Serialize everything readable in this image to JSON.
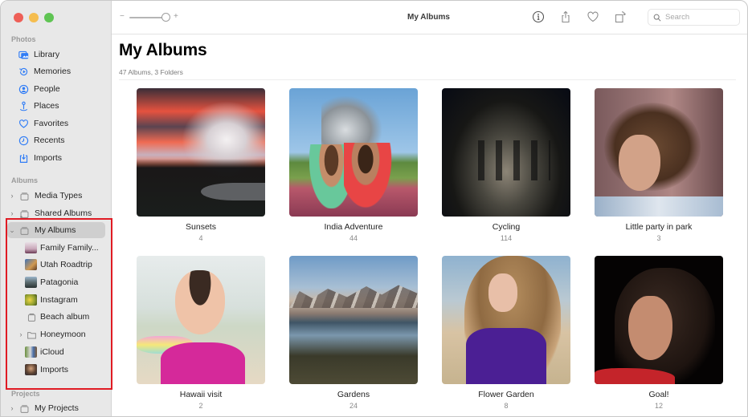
{
  "window": {
    "title": "My Albums"
  },
  "sidebar": {
    "sections": {
      "photos": "Photos",
      "albums": "Albums",
      "projects": "Projects"
    },
    "photos_items": [
      {
        "label": "Library",
        "icon": "library-icon"
      },
      {
        "label": "Memories",
        "icon": "memories-icon"
      },
      {
        "label": "People",
        "icon": "people-icon"
      },
      {
        "label": "Places",
        "icon": "places-icon"
      },
      {
        "label": "Favorites",
        "icon": "heart-icon"
      },
      {
        "label": "Recents",
        "icon": "clock-icon"
      },
      {
        "label": "Imports",
        "icon": "import-icon"
      }
    ],
    "albums_items": [
      {
        "label": "Media Types",
        "expanded": false
      },
      {
        "label": "Shared Albums",
        "expanded": false
      },
      {
        "label": "My Albums",
        "expanded": true,
        "selected": true
      }
    ],
    "my_albums_children": [
      {
        "label": "Family Family..."
      },
      {
        "label": "Utah Roadtrip"
      },
      {
        "label": "Patagonia"
      },
      {
        "label": "Instagram"
      },
      {
        "label": "Beach album"
      },
      {
        "label": "Honeymoon",
        "type": "folder"
      },
      {
        "label": "iCloud"
      },
      {
        "label": "Imports"
      }
    ],
    "projects_items": [
      {
        "label": "My Projects"
      }
    ]
  },
  "toolbar": {
    "zoom_minus": "−",
    "zoom_plus": "+",
    "zoom_level": 0.85,
    "search_placeholder": "Search",
    "search_value": ""
  },
  "main": {
    "title": "My Albums",
    "subtitle": "47 Albums, 3 Folders",
    "albums": [
      {
        "name": "Sunsets",
        "count": "4"
      },
      {
        "name": "India Adventure",
        "count": "44"
      },
      {
        "name": "Cycling",
        "count": "114"
      },
      {
        "name": "Little party in park",
        "count": "3"
      },
      {
        "name": "Hawaii visit",
        "count": "2"
      },
      {
        "name": "Gardens",
        "count": "24"
      },
      {
        "name": "Flower Garden",
        "count": "8"
      },
      {
        "name": "Goal!",
        "count": "12"
      }
    ]
  },
  "colors": {
    "accent": "#2f7cf6",
    "highlight_box": "#e01b24",
    "sidebar_bg": "#e8e8e8",
    "selected_row": "#cfcfcf"
  }
}
